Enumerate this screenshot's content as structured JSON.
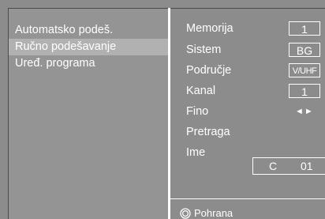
{
  "menu": {
    "items": [
      {
        "label": "Automatsko podeš.",
        "selected": false
      },
      {
        "label": "Ručno podešavanje",
        "selected": true
      },
      {
        "label": "Uređ. programa",
        "selected": false
      }
    ]
  },
  "settings": {
    "memorija": {
      "label": "Memorija",
      "value": "1"
    },
    "sistem": {
      "label": "Sistem",
      "value": "BG"
    },
    "podrucje": {
      "label": "Područje",
      "value": "V/UHF"
    },
    "kanal": {
      "label": "Kanal",
      "value": "1"
    },
    "fino": {
      "label": "Fino",
      "value": "◄►"
    },
    "pretraga": {
      "label": "Pretraga"
    },
    "ime": {
      "label": "Ime",
      "value_prefix": "C",
      "value_number": "01"
    }
  },
  "footer": {
    "icon": "ok-button-icon",
    "label": "Pohrana"
  },
  "colors": {
    "panel_background": "#8c8c8c",
    "selected_highlight": "#b1b1b1",
    "text": "#ffffff"
  }
}
